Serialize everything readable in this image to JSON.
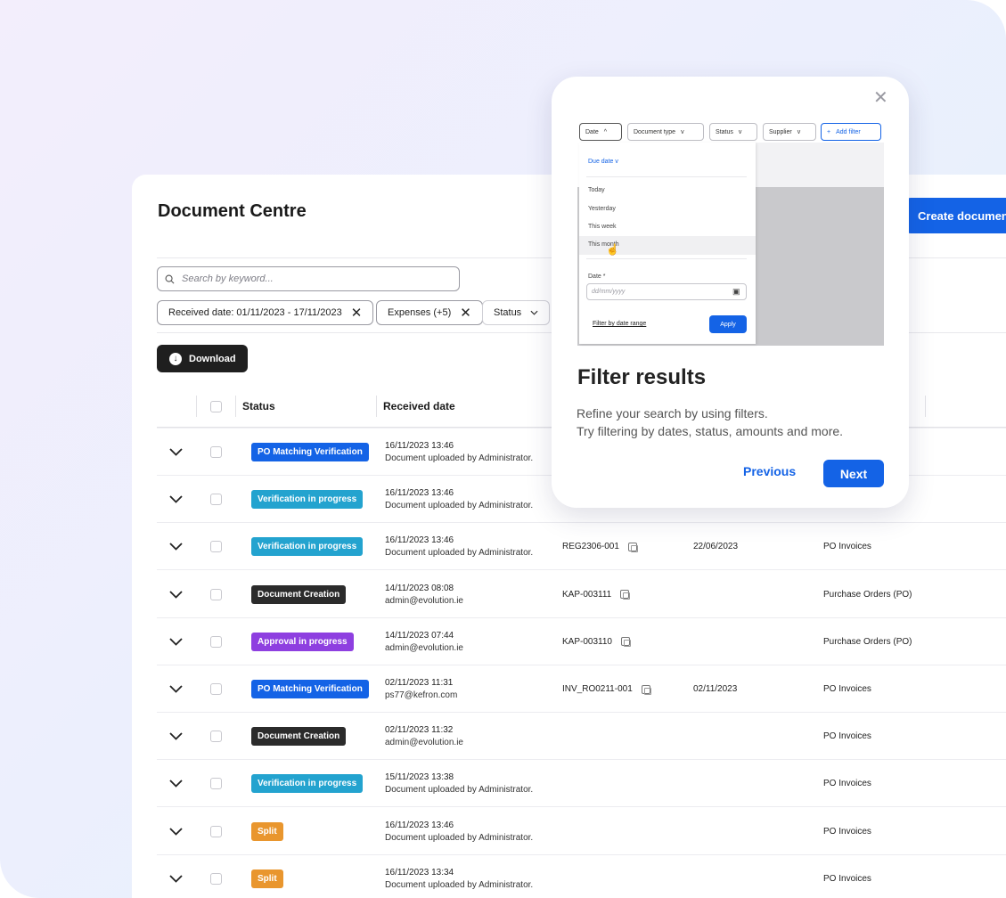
{
  "page": {
    "title": "Document Centre",
    "create_button": "Create document",
    "search_placeholder": "Search by keyword...",
    "filters": [
      {
        "label": "Received date: 01/11/2023 - 17/11/2023"
      },
      {
        "label": "Expenses (+5)"
      },
      {
        "label": "Status"
      }
    ],
    "download_label": "Download"
  },
  "table": {
    "headers": {
      "status": "Status",
      "received": "Received date"
    },
    "rows": [
      {
        "status": "PO Matching Verification",
        "status_color": "#1463e6",
        "date": "16/11/2023 13:46",
        "by": "Document uploaded by Administrator.",
        "ref": "",
        "due": "",
        "type": ""
      },
      {
        "status": "Verification in progress",
        "status_color": "#23a3cf",
        "date": "16/11/2023 13:46",
        "by": "Document uploaded by Administrator.",
        "ref": "",
        "due": "",
        "type": ""
      },
      {
        "status": "Verification in progress",
        "status_color": "#23a3cf",
        "date": "16/11/2023 13:46",
        "by": "Document uploaded by Administrator.",
        "ref": "REG2306-001",
        "due": "22/06/2023",
        "type": "PO Invoices"
      },
      {
        "status": "Document Creation",
        "status_color": "#2b2b2b",
        "date": "14/11/2023 08:08",
        "by": "admin@evolution.ie",
        "ref": "KAP-003111",
        "due": "",
        "type": "Purchase Orders (PO)"
      },
      {
        "status": "Approval in progress",
        "status_color": "#8e3fe0",
        "date": "14/11/2023 07:44",
        "by": "admin@evolution.ie",
        "ref": "KAP-003110",
        "due": "",
        "type": "Purchase Orders (PO)"
      },
      {
        "status": "PO Matching Verification",
        "status_color": "#1463e6",
        "date": "02/11/2023 11:31",
        "by": "ps77@kefron.com",
        "ref": "INV_RO0211-001",
        "due": "02/11/2023",
        "type": "PO Invoices"
      },
      {
        "status": "Document Creation",
        "status_color": "#2b2b2b",
        "date": "02/11/2023 11:32",
        "by": "admin@evolution.ie",
        "ref": "",
        "due": "",
        "type": "PO Invoices"
      },
      {
        "status": "Verification in progress",
        "status_color": "#23a3cf",
        "date": "15/11/2023 13:38",
        "by": "Document uploaded by Administrator.",
        "ref": "",
        "due": "",
        "type": "PO Invoices"
      },
      {
        "status": "Split",
        "status_color": "#e9962e",
        "date": "16/11/2023 13:46",
        "by": "Document uploaded by Administrator.",
        "ref": "",
        "due": "",
        "type": "PO Invoices"
      },
      {
        "status": "Split",
        "status_color": "#e9962e",
        "date": "16/11/2023 13:34",
        "by": "Document uploaded by Administrator.",
        "ref": "",
        "due": "",
        "type": "PO Invoices"
      }
    ]
  },
  "popover": {
    "title": "Filter results",
    "description_line1": "Refine your search by using filters.",
    "description_line2": "Try filtering by dates, status, amounts and more.",
    "previous": "Previous",
    "next": "Next",
    "preview": {
      "chips": [
        "Date",
        "Document type",
        "Status",
        "Supplier",
        "Add filter"
      ],
      "due_date": "Due date",
      "options": [
        "Today",
        "Yesterday",
        "This week",
        "This month"
      ],
      "date_label": "Date *",
      "date_placeholder": "dd/mm/yyyy",
      "range_link": "Filter by date range",
      "apply": "Apply"
    }
  }
}
